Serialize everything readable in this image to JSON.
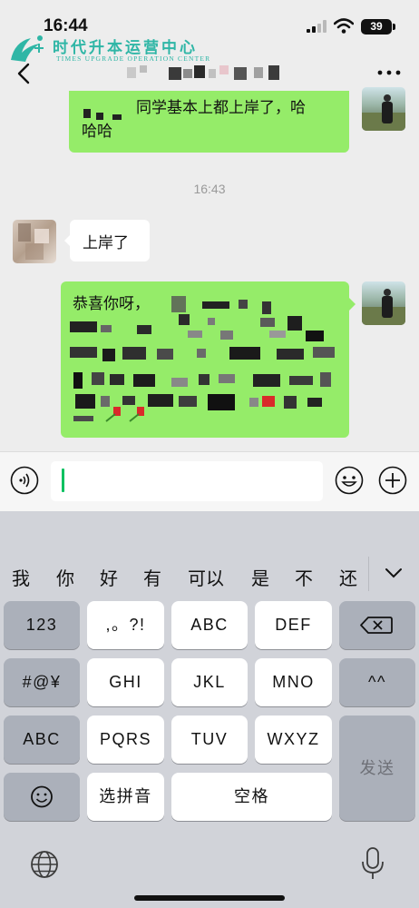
{
  "status_bar": {
    "time": "16:44",
    "battery": "39"
  },
  "watermark": {
    "title": "时代升本运营中心",
    "subtitle": "TIMES UPGRADE OPERATION CENTER"
  },
  "chat": {
    "messages": [
      {
        "side": "right",
        "line1": "同学基本上都上岸了，哈",
        "line2": "哈哈"
      },
      {
        "side": "left",
        "text": "上岸了"
      },
      {
        "side": "right",
        "text": "恭喜你呀，"
      }
    ],
    "time_separator": "16:43"
  },
  "input": {
    "value": ""
  },
  "keyboard": {
    "candidates": [
      "我",
      "你",
      "好",
      "有",
      "可以",
      "是",
      "不",
      "还"
    ],
    "keys": {
      "num": "123",
      "punct": ",。?!",
      "abc": "ABC",
      "def": "DEF",
      "ghi": "GHI",
      "jkl": "JKL",
      "mno": "MNO",
      "symbols": "#@¥",
      "emoticon": "^^",
      "abc_mode": "ABC",
      "pqrs": "PQRS",
      "tuv": "TUV",
      "wxyz": "WXYZ",
      "send": "发送",
      "pinyin": "选拼音",
      "space": "空格"
    }
  },
  "icons": {
    "back": "chevron-left-icon",
    "more": "more-dots-icon",
    "voice": "voice-icon",
    "emoji": "emoji-icon",
    "plus": "plus-icon",
    "backspace": "backspace-icon",
    "globe": "globe-icon",
    "mic": "microphone-icon"
  },
  "colors": {
    "bubble_green": "#95ec69",
    "accent": "#07c160",
    "watermark": "#2fb6a6"
  }
}
